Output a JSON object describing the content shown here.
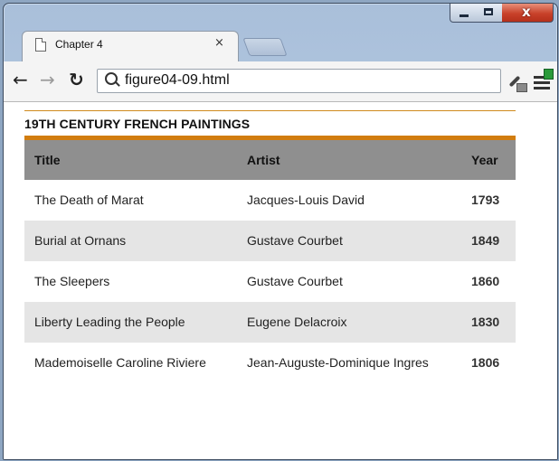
{
  "browser": {
    "tab_title": "Chapter 4",
    "tab_close": "×",
    "url": "figure04-09.html",
    "window_controls": {
      "close_glyph": "x"
    }
  },
  "page": {
    "caption": "19TH CENTURY FRENCH PAINTINGS",
    "table": {
      "headers": [
        "Title",
        "Artist",
        "Year"
      ],
      "rows": [
        [
          "The Death of Marat",
          "Jacques-Louis David",
          "1793"
        ],
        [
          "Burial at Ornans",
          "Gustave Courbet",
          "1849"
        ],
        [
          "The Sleepers",
          "Gustave Courbet",
          "1860"
        ],
        [
          "Liberty Leading the People",
          "Eugene Delacroix",
          "1830"
        ],
        [
          "Mademoiselle Caroline Riviere",
          "Jean-Auguste-Dominique Ingres",
          "1806"
        ]
      ]
    }
  },
  "colors": {
    "accent": "#d17d10",
    "header_bg": "#8f8f8f",
    "alt_row_bg": "#e5e5e5"
  },
  "icons": [
    "page-icon",
    "back-icon",
    "forward-icon",
    "reload-icon",
    "search-icon",
    "dropper-icon",
    "menu-icon"
  ]
}
